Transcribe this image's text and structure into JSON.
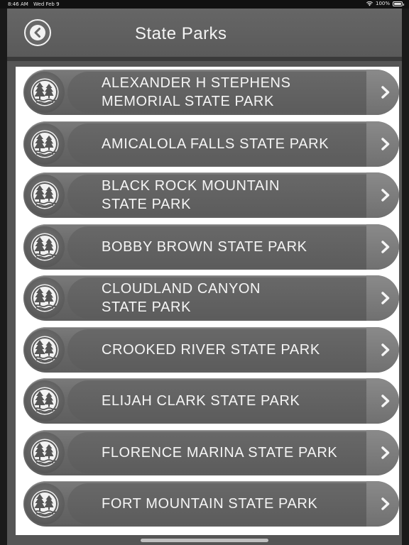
{
  "status_bar": {
    "time": "8:46 AM",
    "date": "Wed Feb 9",
    "battery": "100%"
  },
  "header": {
    "title": "State Parks",
    "back_icon": "back-arrow-icon"
  },
  "list": {
    "items": [
      {
        "label": "ALEXANDER H STEPHENS\nMEMORIAL STATE PARK",
        "icon": "park-trees-icon"
      },
      {
        "label": "AMICALOLA FALLS STATE PARK",
        "icon": "park-trees-icon"
      },
      {
        "label": "BLACK ROCK MOUNTAIN\nSTATE PARK",
        "icon": "park-trees-icon"
      },
      {
        "label": "BOBBY BROWN STATE PARK",
        "icon": "park-trees-icon"
      },
      {
        "label": "CLOUDLAND CANYON\nSTATE PARK",
        "icon": "park-trees-icon"
      },
      {
        "label": "CROOKED RIVER STATE PARK",
        "icon": "park-trees-icon"
      },
      {
        "label": "ELIJAH CLARK STATE PARK",
        "icon": "park-trees-icon"
      },
      {
        "label": "FLORENCE MARINA STATE PARK",
        "icon": "park-trees-icon"
      },
      {
        "label": "FORT MOUNTAIN STATE PARK",
        "icon": "park-trees-icon"
      }
    ]
  }
}
